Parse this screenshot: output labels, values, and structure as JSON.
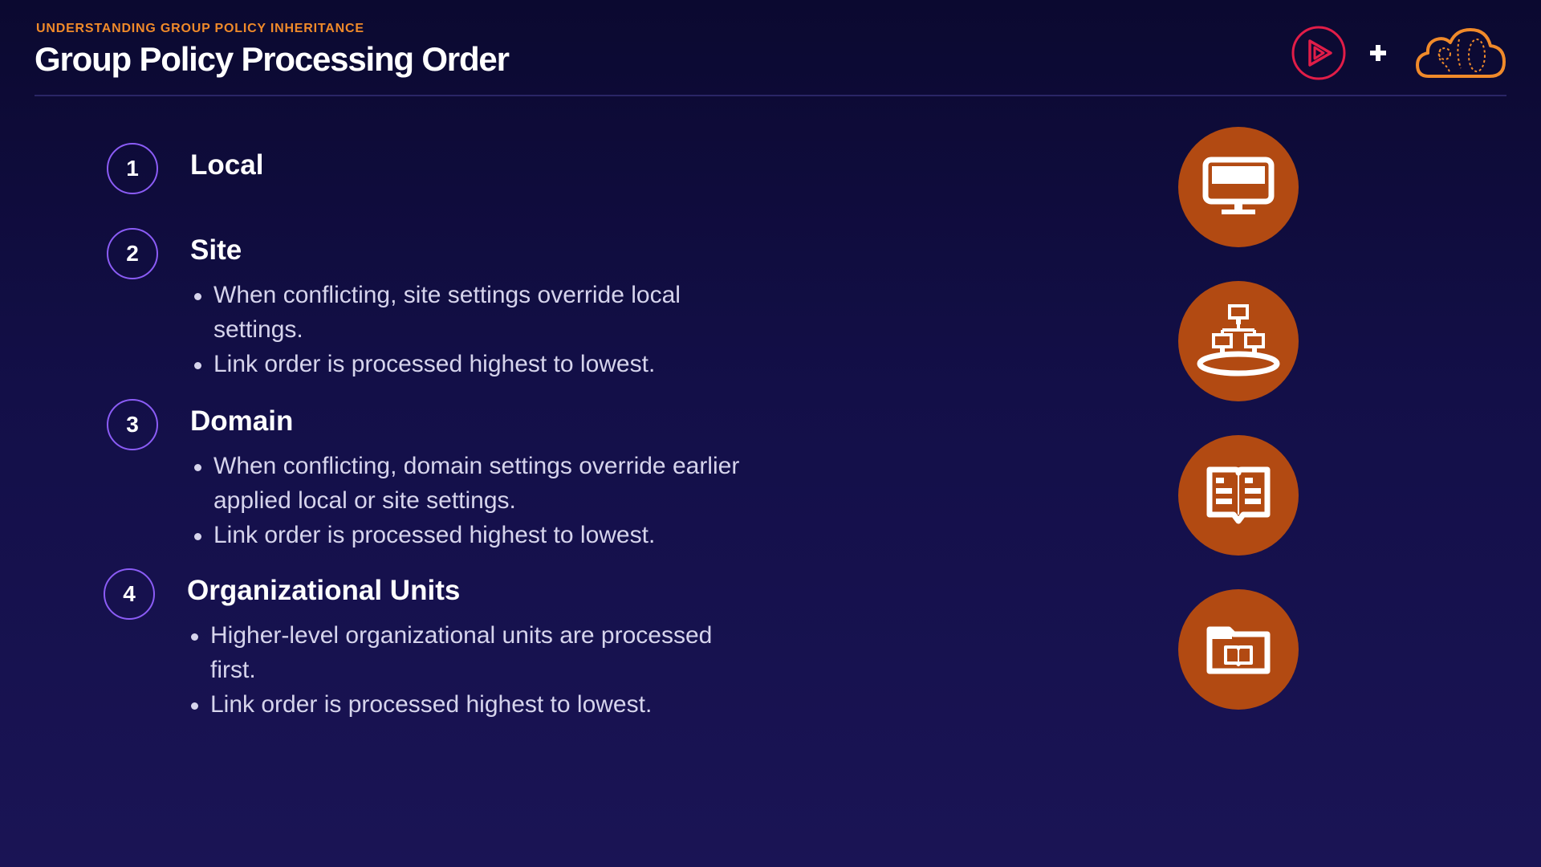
{
  "header": {
    "eyebrow": "UNDERSTANDING GROUP POLICY INHERITANCE",
    "title": "Group Policy Processing Order"
  },
  "brand": {
    "logos": [
      "play-logo-icon",
      "plus-icon",
      "cloud-logo-icon"
    ],
    "colors": {
      "play_logo": "#e11d48",
      "cloud_logo": "#f08a2a"
    }
  },
  "steps": [
    {
      "number": "1",
      "title": "Local",
      "bullets": [],
      "icon": "desktop-computer-icon"
    },
    {
      "number": "2",
      "title": "Site",
      "bullets": [
        "When conflicting, site settings override local settings.",
        "Link order is processed highest to lowest."
      ],
      "icon": "site-network-icon"
    },
    {
      "number": "3",
      "title": "Domain",
      "bullets": [
        "When conflicting, domain settings override earlier applied local or site settings.",
        "Link order is processed highest to lowest."
      ],
      "icon": "domain-book-icon"
    },
    {
      "number": "4",
      "title": "Organizational Units",
      "bullets": [
        "Higher-level organizational units are processed first.",
        "Link order is processed highest to lowest."
      ],
      "icon": "ou-folder-icon"
    }
  ],
  "colors": {
    "accent": "#f08a2a",
    "number_ring": "#8b5cf6",
    "icon_fill": "#b24a12",
    "background_top": "#0b0930",
    "background_bottom": "#1a1455"
  }
}
